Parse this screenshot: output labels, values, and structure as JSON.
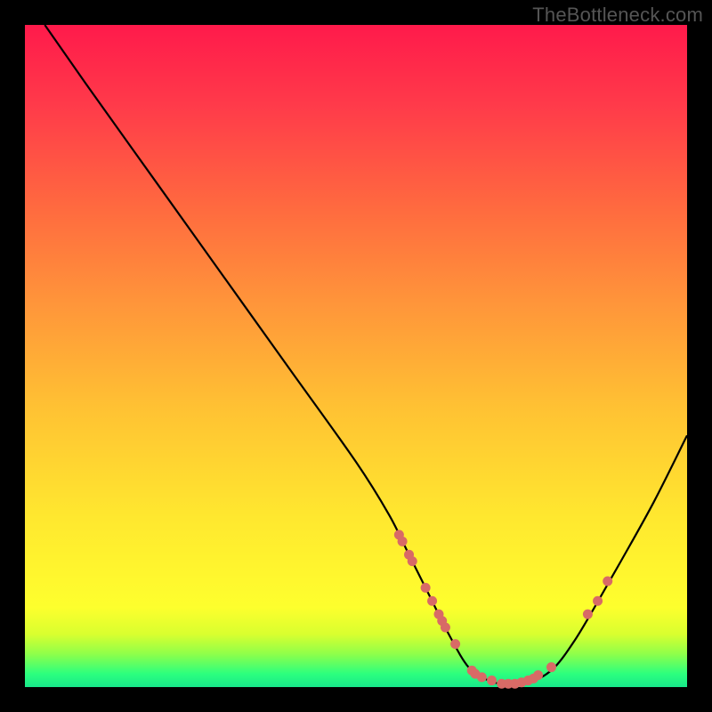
{
  "watermark": "TheBottleneck.com",
  "chart_data": {
    "type": "line",
    "title": "",
    "xlabel": "",
    "ylabel": "",
    "xlim": [
      0,
      100
    ],
    "ylim": [
      0,
      100
    ],
    "series": [
      {
        "name": "curve",
        "x": [
          3,
          10,
          20,
          30,
          40,
          50,
          55,
          58,
          61,
          64,
          67,
          70,
          72,
          74,
          77,
          80,
          83,
          86,
          90,
          95,
          100
        ],
        "y": [
          100,
          90,
          76,
          62,
          48,
          34,
          26,
          20,
          14,
          8,
          3,
          1,
          0.5,
          0.5,
          1,
          3,
          7,
          12,
          19,
          28,
          38
        ]
      }
    ],
    "markers_left": [
      {
        "x": 56.5,
        "y": 23
      },
      {
        "x": 57.0,
        "y": 22
      },
      {
        "x": 58.0,
        "y": 20
      },
      {
        "x": 58.5,
        "y": 19
      },
      {
        "x": 60.5,
        "y": 15
      },
      {
        "x": 61.5,
        "y": 13
      },
      {
        "x": 62.5,
        "y": 11
      },
      {
        "x": 63.0,
        "y": 10
      },
      {
        "x": 63.5,
        "y": 9
      },
      {
        "x": 65.0,
        "y": 6.5
      }
    ],
    "markers_bottom": [
      {
        "x": 67.5,
        "y": 2.5
      },
      {
        "x": 68.0,
        "y": 2.0
      },
      {
        "x": 69.0,
        "y": 1.5
      },
      {
        "x": 70.5,
        "y": 1.0
      },
      {
        "x": 72.0,
        "y": 0.5
      },
      {
        "x": 73.0,
        "y": 0.5
      },
      {
        "x": 74.0,
        "y": 0.5
      },
      {
        "x": 75.0,
        "y": 0.7
      },
      {
        "x": 76.0,
        "y": 1.0
      },
      {
        "x": 76.8,
        "y": 1.3
      },
      {
        "x": 77.5,
        "y": 1.8
      },
      {
        "x": 79.5,
        "y": 3.0
      }
    ],
    "markers_right": [
      {
        "x": 85.0,
        "y": 11
      },
      {
        "x": 86.5,
        "y": 13
      },
      {
        "x": 88.0,
        "y": 16
      }
    ]
  }
}
